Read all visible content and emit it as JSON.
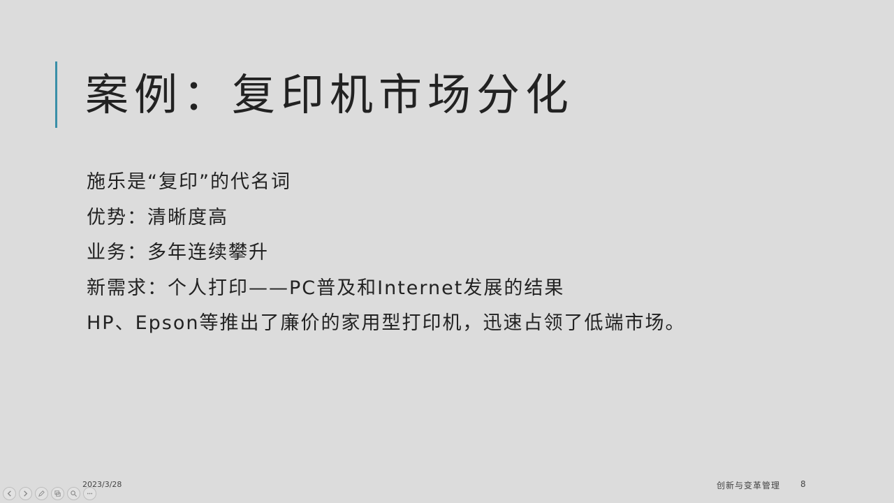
{
  "slide": {
    "title": "案例：复印机市场分化",
    "bullets": [
      "施乐是“复印”的代名词",
      "优势：清晰度高",
      "业务：多年连续攀升",
      "新需求：个人打印——PC普及和Internet发展的结果",
      "HP、Epson等推出了廉价的家用型打印机，迅速占领了低端市场。"
    ],
    "accent_color": "#3a8fa8"
  },
  "footer": {
    "date": "2023/3/28",
    "course": "创新与变革管理",
    "page_number": "8"
  },
  "toolbar": {
    "icons": [
      "previous-icon",
      "next-icon",
      "pen-icon",
      "slides-icon",
      "zoom-icon",
      "more-icon"
    ]
  }
}
